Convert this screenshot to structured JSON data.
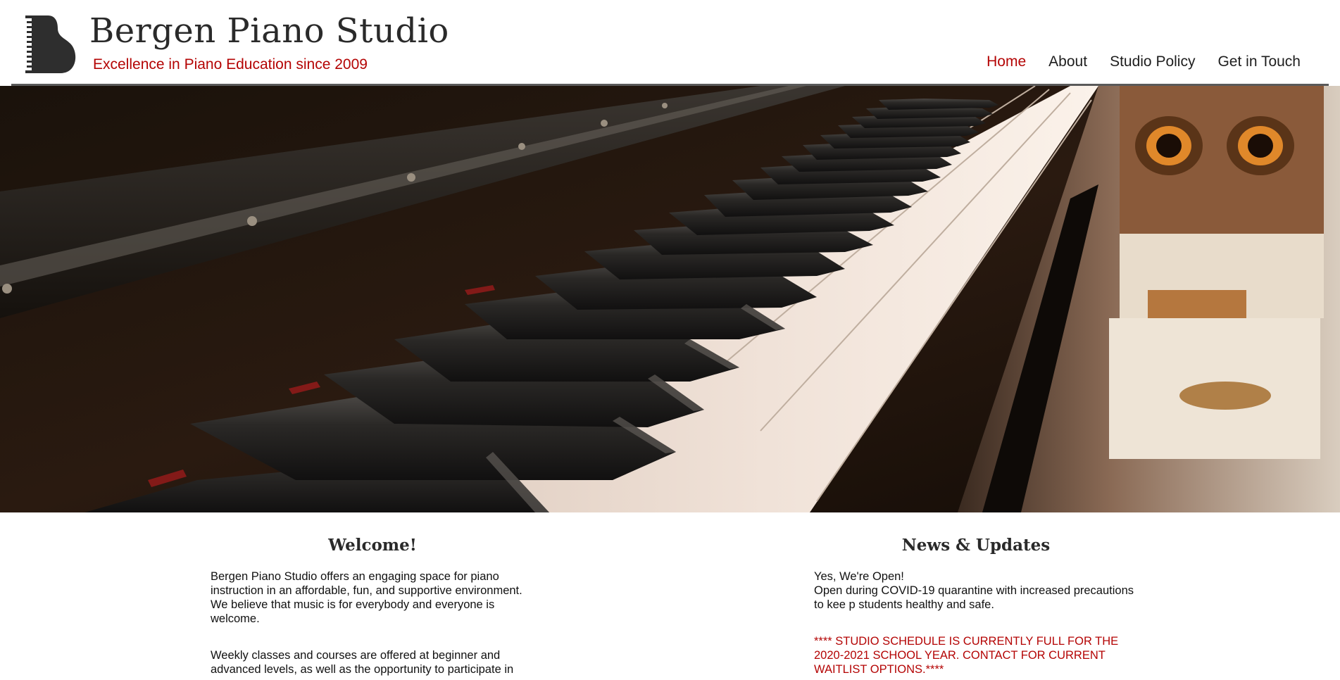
{
  "header": {
    "logo_icon": "grand-piano-logo-icon",
    "title": "Bergen Piano Studio",
    "tagline": "Excellence in Piano Education since 2009"
  },
  "nav": {
    "items": [
      {
        "label": "Home",
        "active": true
      },
      {
        "label": "About",
        "active": false
      },
      {
        "label": "Studio Policy",
        "active": false
      },
      {
        "label": "Get in Touch",
        "active": false
      }
    ]
  },
  "hero": {
    "image": "piano-keyboard-photo"
  },
  "welcome": {
    "heading": "Welcome!",
    "paragraph_1": "Bergen Piano Studio offers an engaging space for piano instruction in an affordable, fun, and supportive environment. We believe that music is for everybody and everyone is welcome.",
    "paragraph_2": "Weekly classes and courses are offered at beginner and advanced levels, as well as the opportunity to participate in"
  },
  "news": {
    "heading": "News & Updates",
    "line_1": "Yes, We're Open!",
    "line_2": "Open during COVID-19 quarantine with increased precautions to kee p students healthy and safe.",
    "alert": "**** STUDIO SCHEDULE IS CURRENTLY FULL FOR THE 2020-2021 SCHOOL YEAR. CONTACT FOR CURRENT WAITLIST OPTIONS.****"
  },
  "colors": {
    "accent_red": "#b40404",
    "text_dark": "#1a1a1a",
    "rule_gray": "#5a5a5a"
  }
}
